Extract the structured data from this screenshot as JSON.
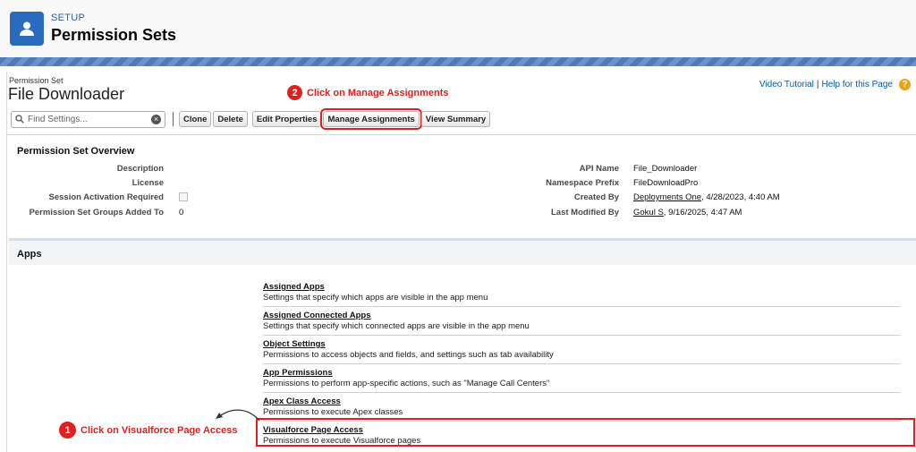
{
  "header": {
    "setup_label": "SETUP",
    "title": "Permission Sets",
    "icon": "user-icon"
  },
  "page": {
    "type_label": "Permission Set",
    "title": "File Downloader"
  },
  "top_links": {
    "video_tutorial": "Video Tutorial",
    "separator": "|",
    "help": "Help for this Page",
    "help_icon": "?"
  },
  "annotations": {
    "step2": {
      "number": "2",
      "text": "Click on Manage Assignments"
    },
    "step1": {
      "number": "1",
      "text": "Click on Visualforce Page Access"
    }
  },
  "toolbar": {
    "search_placeholder": "Find Settings...",
    "buttons": [
      "Clone",
      "Delete",
      "Edit Properties",
      "Manage Assignments",
      "View Summary"
    ]
  },
  "overview": {
    "title": "Permission Set Overview",
    "left": [
      {
        "label": "Description",
        "value": ""
      },
      {
        "label": "License",
        "value": ""
      },
      {
        "label": "Session Activation Required",
        "value": ""
      },
      {
        "label": "Permission Set Groups Added To",
        "value": "0"
      }
    ],
    "right": [
      {
        "label": "API Name",
        "value": "File_Downloader"
      },
      {
        "label": "Namespace Prefix",
        "value": "FileDownloadPro"
      },
      {
        "label": "Created By",
        "link": "Deployments One",
        "value": ", 4/28/2023, 4:40 AM"
      },
      {
        "label": "Last Modified By",
        "link": "Gokul S",
        "value": ", 9/16/2025, 4:47 AM"
      }
    ]
  },
  "apps": {
    "title": "Apps",
    "items": [
      {
        "name": "Assigned Apps",
        "desc": "Settings that specify which apps are visible in the app menu"
      },
      {
        "name": "Assigned Connected Apps",
        "desc": "Settings that specify which connected apps are visible in the app menu"
      },
      {
        "name": "Object Settings",
        "desc": "Permissions to access objects and fields, and settings such as tab availability"
      },
      {
        "name": "App Permissions",
        "desc": "Permissions to perform app-specific actions, such as \"Manage Call Centers\""
      },
      {
        "name": "Apex Class Access",
        "desc": "Permissions to execute Apex classes"
      },
      {
        "name": "Visualforce Page Access",
        "desc": "Permissions to execute Visualforce pages"
      }
    ]
  },
  "colors": {
    "highlight": "#e02020",
    "header_icon_bg": "#2a6abf",
    "link": "#015ba7"
  }
}
